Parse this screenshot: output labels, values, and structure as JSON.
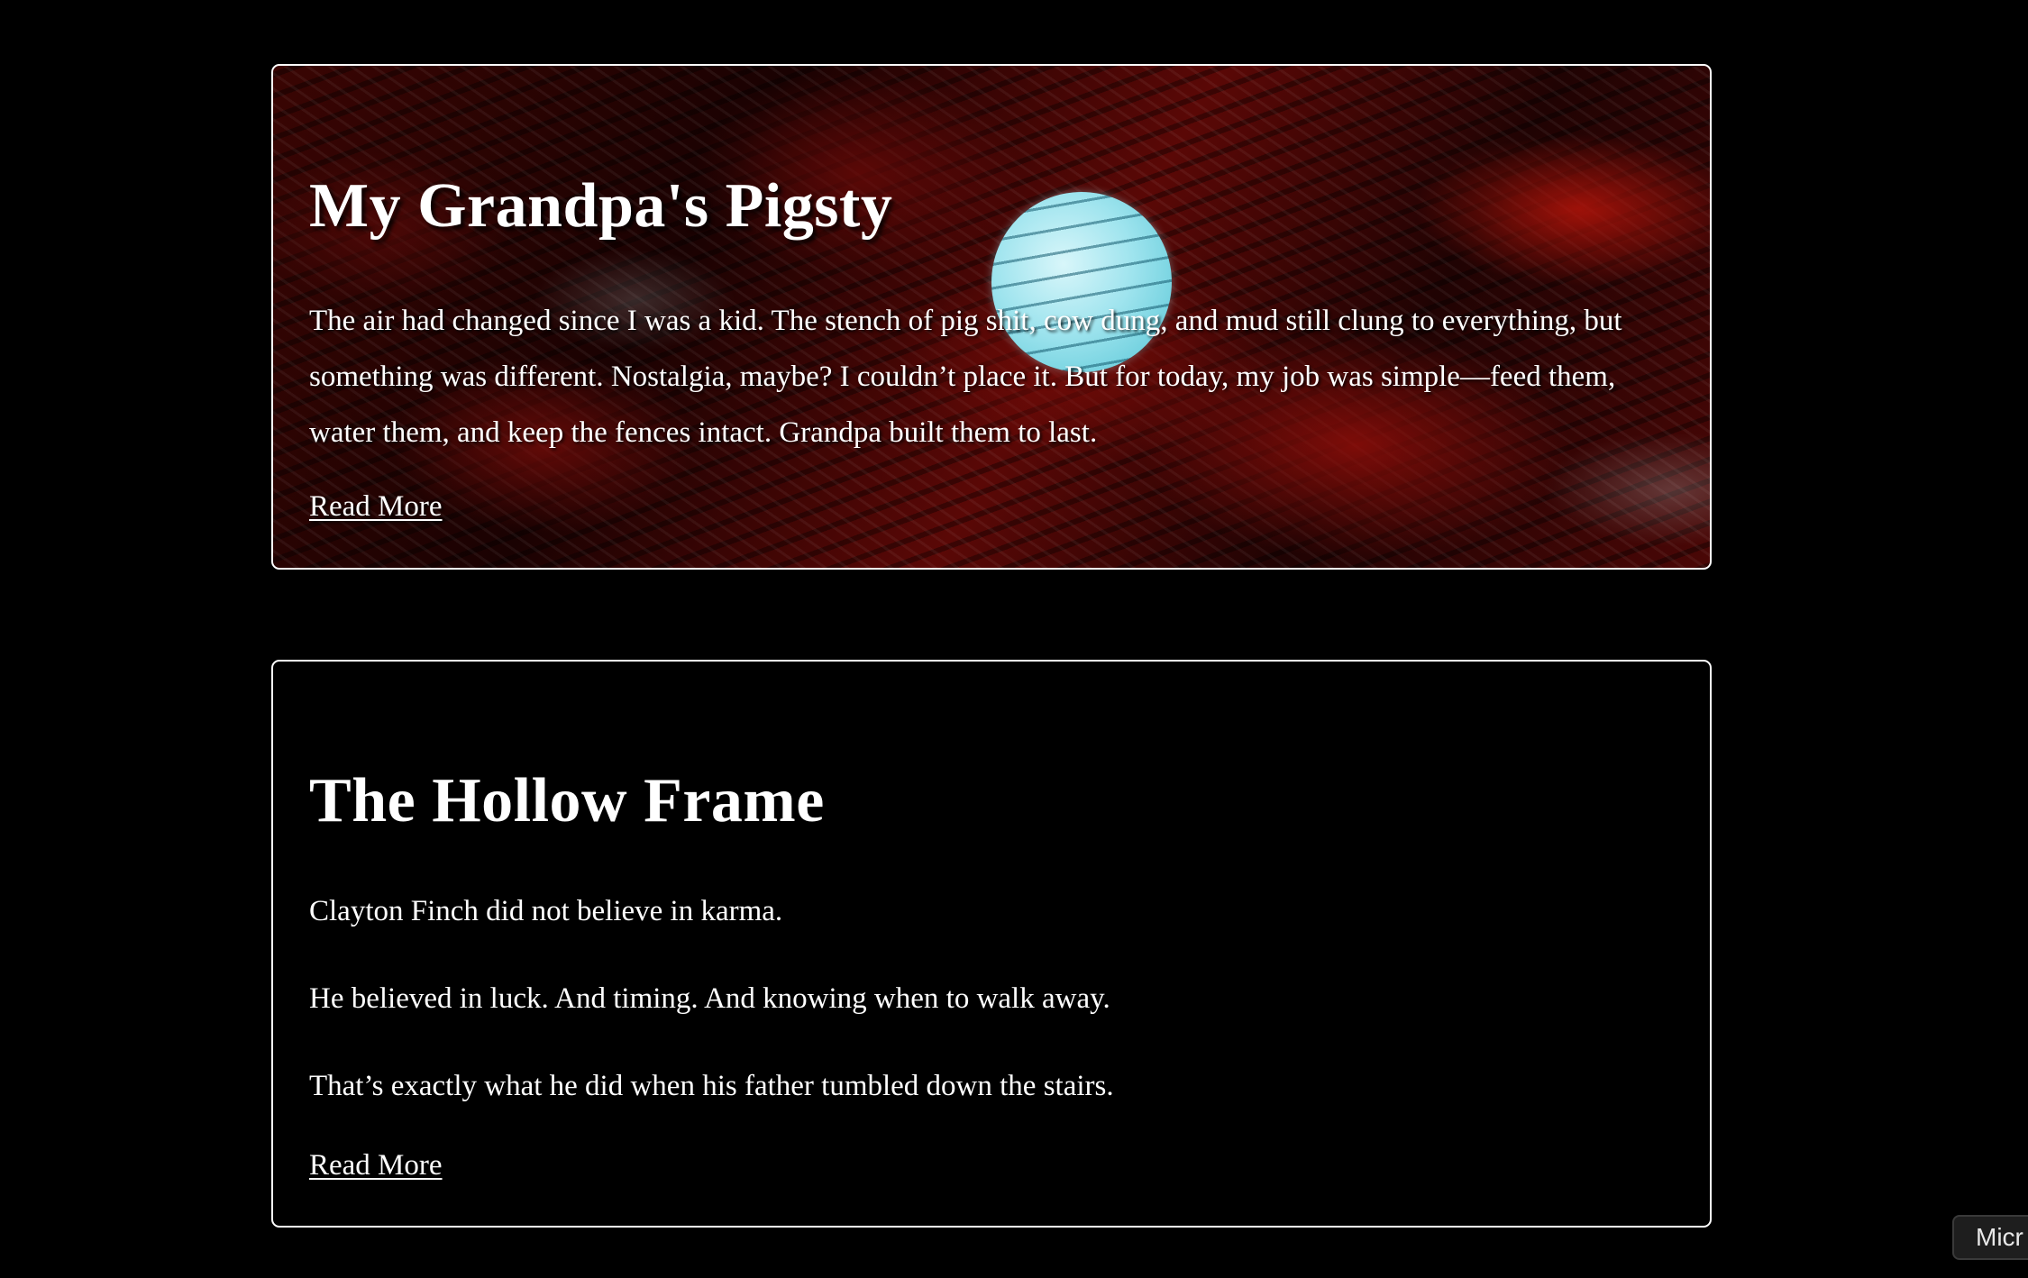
{
  "stories": [
    {
      "title": "My Grandpa's Pigsty",
      "excerpt": "The air had changed since I was a kid. The stench of pig shit, cow dung, and mud still clung to everything, but something was different. Nostalgia, maybe? I couldn’t place it. But for today, my job was simple—feed them, water them, and keep the fences intact. Grandpa built them to last.",
      "read_more_label": "Read More"
    },
    {
      "title": "The Hollow Frame",
      "paragraphs": [
        "Clayton Finch did not believe in karma.",
        "He believed in luck. And timing. And knowing when to walk away.",
        "That’s exactly what he did when his father tumbled down the stairs."
      ],
      "read_more_label": "Read More"
    }
  ],
  "corner_chip_text": "Micr",
  "colors": {
    "background": "#000000",
    "text": "#ffffff",
    "card_border": "#ffffff",
    "bubble": "#9fe4ee",
    "texture_red": "#5a0806"
  },
  "icons": {
    "bubble": "cyan-circle-decoration"
  }
}
